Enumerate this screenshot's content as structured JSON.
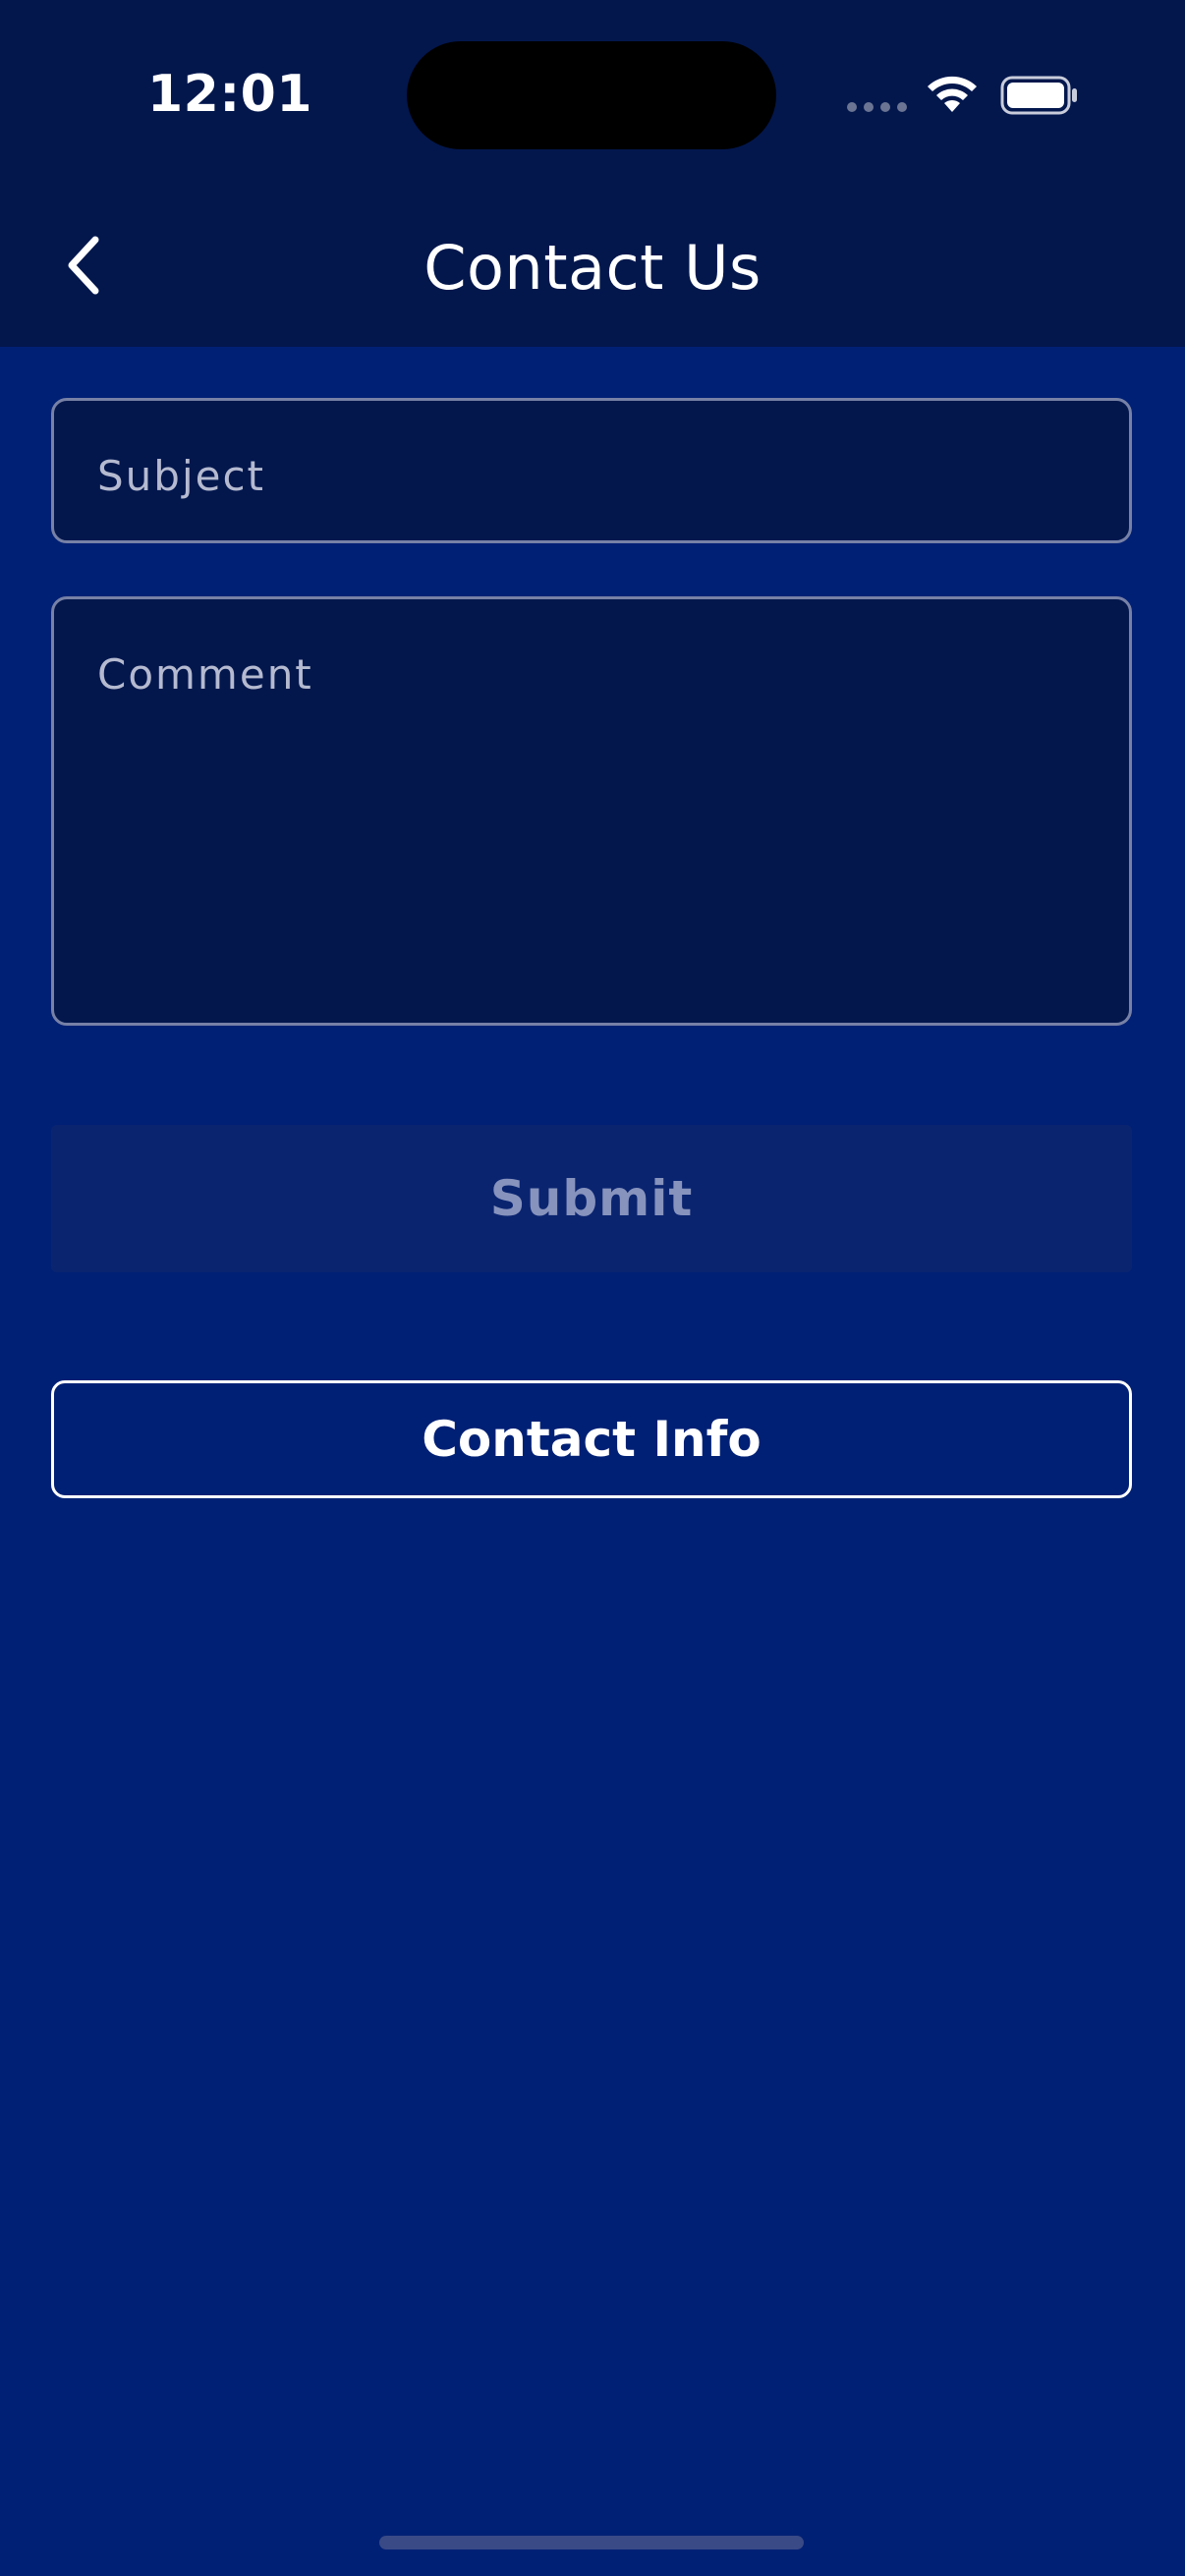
{
  "status_bar": {
    "time": "12:01"
  },
  "header": {
    "title": "Contact Us",
    "back_icon": "chevron-left-icon"
  },
  "form": {
    "subject": {
      "placeholder": "Subject",
      "value": ""
    },
    "comment": {
      "placeholder": "Comment",
      "value": ""
    },
    "submit_label": "Submit",
    "contact_info_label": "Contact Info"
  },
  "colors": {
    "background": "#002075",
    "header_background": "#03174d",
    "field_background": "#03174d",
    "field_border": "#7781a6",
    "submit_disabled_text": "#8793bd",
    "text_primary": "#ffffff"
  }
}
